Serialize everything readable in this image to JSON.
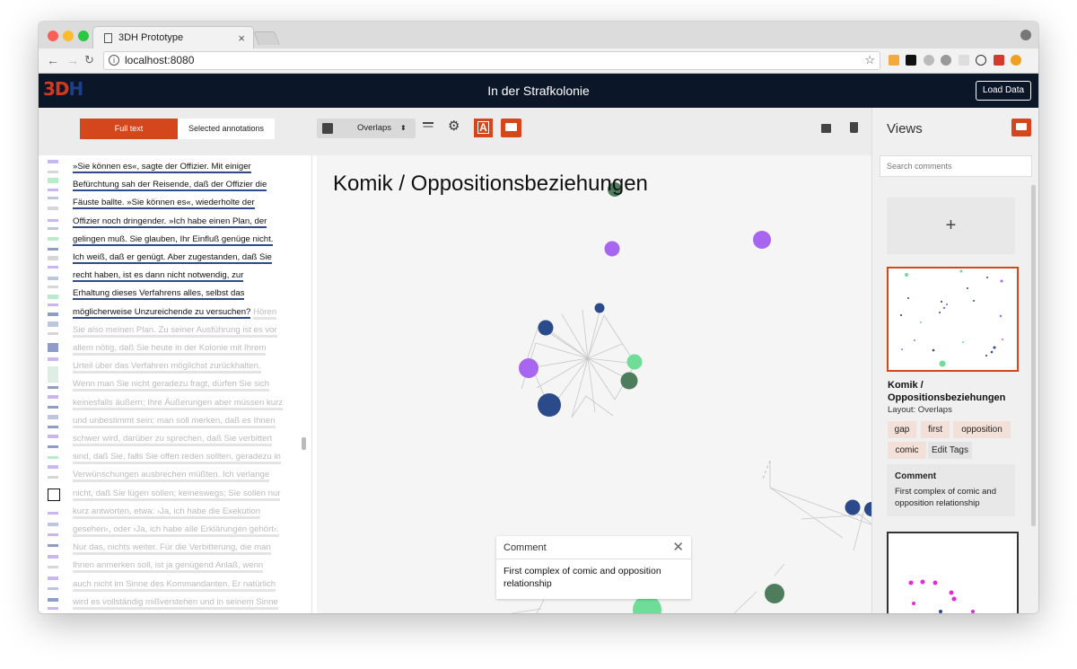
{
  "browser": {
    "tab_title": "3DH Prototype",
    "tab_close": "×",
    "url": "localhost:8080"
  },
  "app": {
    "logo_a": "3D",
    "logo_b": "H",
    "title": "In der Strafkolonie",
    "load_button": "Load Data"
  },
  "left": {
    "tabs": [
      "Full text",
      "Selected annotations"
    ],
    "active_tab": "Full text",
    "highlighted_lines": [
      "»Sie können es«, sagte der Offizier. Mit einiger",
      "Befürchtung sah der Reisende, daß der Offizier die",
      "Fäuste ballte. »Sie können es«, wiederholte der",
      "Offizier noch dringender. »Ich habe einen Plan, der",
      "gelingen muß. Sie glauben, Ihr Einfluß genüge nicht.",
      "Ich weiß, daß er genügt. Aber zugestanden, daß Sie",
      "recht haben, ist es dann nicht notwendig, zur",
      "Erhaltung dieses Verfahrens alles, selbst das",
      "möglicherweise Unzureichende zu versuchen?"
    ],
    "dim_lines": [
      "Hören",
      "Sie also meinen Plan. Zu seiner Ausführung ist es vor",
      "allem nötig, daß Sie heute in der Kolonie mit Ihrem",
      "Urteil über das Verfahren möglichst zurückhalten.",
      "Wenn man Sie nicht geradezu fragt, dürfen Sie sich",
      "keinesfalls äußern; Ihre Äußerungen aber müssen kurz",
      "und unbestimmt sein; man soll merken, daß es Ihnen",
      "schwer wird, darüber zu sprechen, daß Sie verbittert",
      "sind, daß Sie, falls Sie offen reden sollten, geradezu in",
      "Verwünschungen ausbrechen müßten. Ich verlange",
      "nicht, daß Sie lügen sollen; keineswegs; Sie sollen nur",
      "kurz antworten, etwa: ›Ja, ich habe die Exekution",
      "gesehen‹, oder ›Ja, ich habe alle Erklärungen gehört‹.",
      "Nur das, nichts weiter. Für die Verbitterung, die man",
      "Ihnen anmerken soll, ist ja genügend Anlaß, wenn",
      "auch nicht im Sinne des Kommandanten. Er natürlich",
      "wird es vollständig mißverstehen und in seinem Sinne"
    ]
  },
  "center": {
    "layout_select": "Overlaps",
    "viz_title": "Komik / Oppositionsbeziehungen",
    "popup": {
      "title": "Comment",
      "close": "✕",
      "body": "First complex of comic and opposition relationship"
    },
    "colors": {
      "navy": "#2b4a8a",
      "purple": "#a865f0",
      "green": "#4e7d5e",
      "light_green": "#6fdc97",
      "accent": "#d4461c"
    }
  },
  "right": {
    "title": "Views",
    "search_placeholder": "Search comments",
    "add_label": "+",
    "view": {
      "name": "Komik / Oppositionsbeziehungen",
      "layout": "Layout: Overlaps",
      "tags": [
        "gap",
        "first",
        "opposition",
        "comic"
      ],
      "edit_tags": "Edit Tags",
      "comment_heading": "Comment",
      "comment_body": "First complex of comic and opposition relationship"
    }
  }
}
